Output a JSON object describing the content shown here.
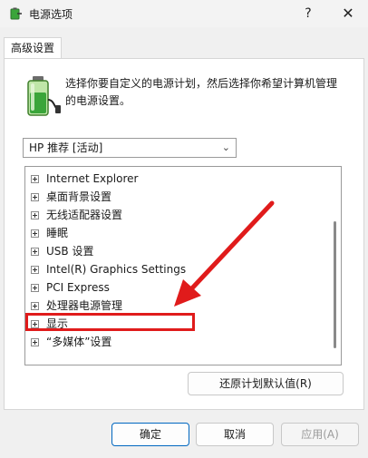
{
  "window": {
    "title": "电源选项",
    "help_glyph": "?",
    "close_glyph": "✕"
  },
  "tab": {
    "label": "高级设置"
  },
  "description": "选择你要自定义的电源计划，然后选择你希望计算机管理的电源设置。",
  "plan_select": {
    "value": "HP 推荐 [活动]",
    "chevron": "⌄"
  },
  "tree_items": [
    "Internet Explorer",
    "桌面背景设置",
    "无线适配器设置",
    "睡眠",
    "USB 设置",
    "Intel(R) Graphics Settings",
    "PCI Express",
    "处理器电源管理",
    "显示",
    "“多媒体”设置"
  ],
  "buttons": {
    "restore": "还原计划默认值(R)",
    "ok": "确定",
    "cancel": "取消",
    "apply": "应用(A)"
  },
  "colors": {
    "annotation_red": "#e01b1b",
    "battery_green": "#3aa53a",
    "default_button_border": "#0067c0"
  },
  "icons": {
    "window": "power-options-icon",
    "panel": "battery-plug-icon"
  }
}
